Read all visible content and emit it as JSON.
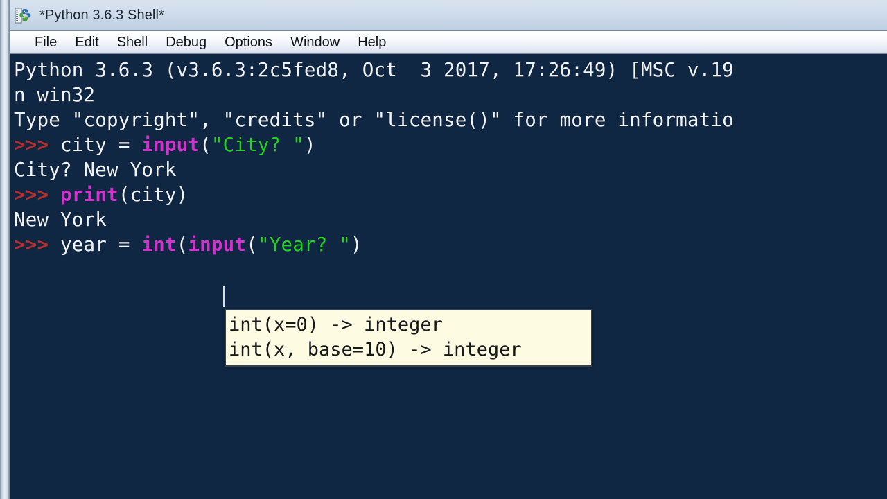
{
  "window": {
    "title": "*Python 3.6.3 Shell*",
    "app_icon": "python-idle-icon",
    "background_color": "#102744",
    "frame_color": "#c6d5e6"
  },
  "menubar": {
    "items": [
      {
        "label": "File"
      },
      {
        "label": "Edit"
      },
      {
        "label": "Shell"
      },
      {
        "label": "Debug"
      },
      {
        "label": "Options"
      },
      {
        "label": "Window"
      },
      {
        "label": "Help"
      }
    ]
  },
  "console": {
    "lines": [
      {
        "id": "banner-line-1",
        "segments": [
          {
            "type": "output",
            "text": "Python 3.6.3 (v3.6.3:2c5fed8, Oct  3 2017, 17:26:49) [MSC v.19"
          }
        ]
      },
      {
        "id": "banner-line-2",
        "segments": [
          {
            "type": "output",
            "text": "n win32"
          }
        ]
      },
      {
        "id": "banner-line-3",
        "segments": [
          {
            "type": "output",
            "text": "Type \"copyright\", \"credits\" or \"license()\" for more informatio"
          }
        ]
      },
      {
        "id": "input-city-statement",
        "segments": [
          {
            "type": "prompt",
            "text": ">>> "
          },
          {
            "type": "name",
            "text": "city = "
          },
          {
            "type": "builtin",
            "text": "input"
          },
          {
            "type": "punct",
            "text": "("
          },
          {
            "type": "string",
            "text": "\"City? \""
          },
          {
            "type": "punct",
            "text": ")"
          }
        ]
      },
      {
        "id": "input-city-echo",
        "segments": [
          {
            "type": "output",
            "text": "City? New York"
          }
        ]
      },
      {
        "id": "print-city-statement",
        "segments": [
          {
            "type": "prompt",
            "text": ">>> "
          },
          {
            "type": "builtin",
            "text": "print"
          },
          {
            "type": "punct",
            "text": "(city)"
          }
        ]
      },
      {
        "id": "print-city-output",
        "segments": [
          {
            "type": "output",
            "text": "New York"
          }
        ]
      },
      {
        "id": "input-year-statement",
        "segments": [
          {
            "type": "prompt",
            "text": ">>> "
          },
          {
            "type": "name",
            "text": "year = "
          },
          {
            "type": "builtin",
            "text": "int"
          },
          {
            "type": "punct",
            "text": "("
          },
          {
            "type": "builtin",
            "text": "input"
          },
          {
            "type": "punct",
            "text": "("
          },
          {
            "type": "string",
            "text": "\"Year? \""
          },
          {
            "type": "punct",
            "text": ")"
          }
        ]
      }
    ]
  },
  "calltip": {
    "lines": [
      "int(x=0) -> integer",
      "int(x, base=10) -> integer"
    ],
    "background_color": "#fdfbe2",
    "border_color": "#33414f"
  },
  "colors": {
    "prompt": "#b02f2f",
    "builtin": "#cf34cf",
    "string": "#22d422",
    "output": "#f0f4f9",
    "console_bg": "#102744"
  }
}
